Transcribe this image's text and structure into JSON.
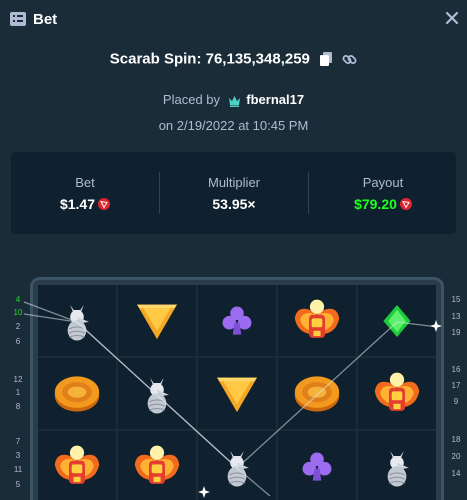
{
  "header": {
    "title": "Bet"
  },
  "game": {
    "name_label": "Scarab Spin:",
    "spin_id": "76,135,348,259"
  },
  "placed": {
    "prefix": "Placed by",
    "username": "fbernal17",
    "date": "on 2/19/2022 at 10:45 PM"
  },
  "stats": {
    "bet_label": "Bet",
    "bet_value": "$1.47",
    "multiplier_label": "Multiplier",
    "multiplier_value": "53.95×",
    "payout_label": "Payout",
    "payout_value": "$79.20"
  },
  "colors": {
    "background": "#1a2c38",
    "panel": "#0f212e",
    "payout_green": "#1fff20",
    "coin_red": "#e0242e",
    "active_line_green": "#1fe020"
  },
  "paylines_left": [
    {
      "num": "4",
      "active": true
    },
    {
      "num": "10",
      "active": true
    },
    {
      "num": "2",
      "active": false
    },
    {
      "num": "6",
      "active": false
    },
    {
      "num": "12",
      "active": false
    },
    {
      "num": "1",
      "active": false
    },
    {
      "num": "8",
      "active": false
    },
    {
      "num": "7",
      "active": false
    },
    {
      "num": "3",
      "active": false
    },
    {
      "num": "11",
      "active": false
    },
    {
      "num": "5",
      "active": false
    }
  ],
  "paylines_right": [
    {
      "num": "15"
    },
    {
      "num": "13"
    },
    {
      "num": "19"
    },
    {
      "num": "16"
    },
    {
      "num": "17"
    },
    {
      "num": "9"
    },
    {
      "num": "18"
    },
    {
      "num": "20"
    },
    {
      "num": "14"
    }
  ],
  "reels": [
    [
      "wolf-statue",
      "coin-disc",
      "scarab"
    ],
    [
      "gold-triangle",
      "wolf-statue",
      "scarab"
    ],
    [
      "club",
      "gold-triangle",
      "wolf-statue"
    ],
    [
      "scarab",
      "coin-disc",
      "club"
    ],
    [
      "diamond",
      "scarab",
      "wolf-statue"
    ]
  ]
}
